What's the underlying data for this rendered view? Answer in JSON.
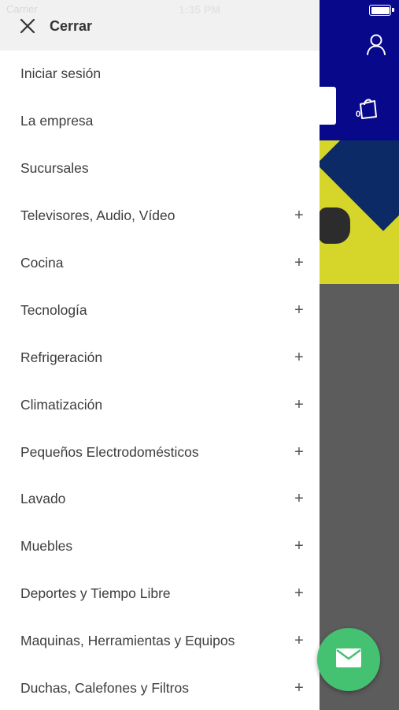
{
  "status_bar": {
    "carrier": "Carrier",
    "time": "1:35 PM"
  },
  "background": {
    "cart_count": "0"
  },
  "drawer": {
    "close_label": "Cerrar",
    "items": [
      {
        "label": "Iniciar sesión",
        "expandable": false
      },
      {
        "label": "La empresa",
        "expandable": false
      },
      {
        "label": "Sucursales",
        "expandable": false
      },
      {
        "label": "Televisores, Audio, Vídeo",
        "expandable": true
      },
      {
        "label": "Cocina",
        "expandable": true
      },
      {
        "label": "Tecnología",
        "expandable": true
      },
      {
        "label": "Refrigeración",
        "expandable": true
      },
      {
        "label": "Climatización",
        "expandable": true
      },
      {
        "label": "Pequeños Electrodomésticos",
        "expandable": true
      },
      {
        "label": "Lavado",
        "expandable": true
      },
      {
        "label": "Muebles",
        "expandable": true
      },
      {
        "label": "Deportes y Tiempo Libre",
        "expandable": true
      },
      {
        "label": "Maquinas, Herramientas y Equipos",
        "expandable": true
      },
      {
        "label": "Duchas, Calefones y Filtros",
        "expandable": true
      }
    ],
    "expand_symbol": "+"
  },
  "colors": {
    "header_blue": "#08088a",
    "fab_green": "#44c171",
    "banner_yellow": "#d6d52a"
  },
  "icons": {
    "close": "close-icon",
    "user": "user-icon",
    "cart": "shopping-bag-icon",
    "mail": "mail-icon",
    "expand": "plus-icon"
  }
}
